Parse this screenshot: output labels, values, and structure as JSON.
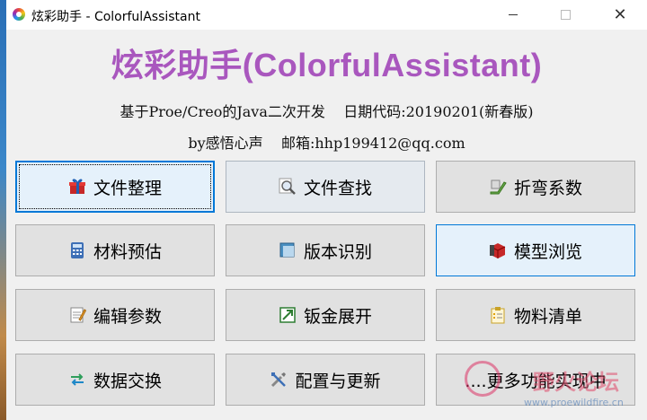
{
  "window": {
    "title": "炫彩助手 - ColorfulAssistant",
    "minimize": "—",
    "maximize": "☐",
    "close": "✕"
  },
  "header": {
    "app_title": "炫彩助手(ColorfulAssistant)",
    "info_line1": "基于Proe/Creo的Java二次开发    日期代码:20190201(新春版)",
    "info_line2": "by感悟心声    邮箱:hhp199412@qq.com"
  },
  "buttons": [
    {
      "label": "文件整理",
      "icon": "gift-box-icon"
    },
    {
      "label": "文件查找",
      "icon": "magnifier-icon"
    },
    {
      "label": "折弯系数",
      "icon": "sheet-bend-icon"
    },
    {
      "label": "材料预估",
      "icon": "calculator-icon"
    },
    {
      "label": "版本识别",
      "icon": "version-square-icon"
    },
    {
      "label": "模型浏览",
      "icon": "red-cube-icon"
    },
    {
      "label": "编辑参数",
      "icon": "notepad-icon"
    },
    {
      "label": "钣金展开",
      "icon": "unfold-arrow-icon"
    },
    {
      "label": "物料清单",
      "icon": "clipboard-list-icon"
    },
    {
      "label": "数据交换",
      "icon": "exchange-arrows-icon"
    },
    {
      "label": "配置与更新",
      "icon": "tools-icon"
    },
    {
      "label": "....更多功能实现中",
      "icon": ""
    }
  ],
  "watermark": {
    "text": "野火论坛",
    "url": "www.proewildfire.cn"
  },
  "colors": {
    "title_purple": "#a957be",
    "focus_blue": "#0078d7",
    "button_face": "#e1e1e1"
  }
}
